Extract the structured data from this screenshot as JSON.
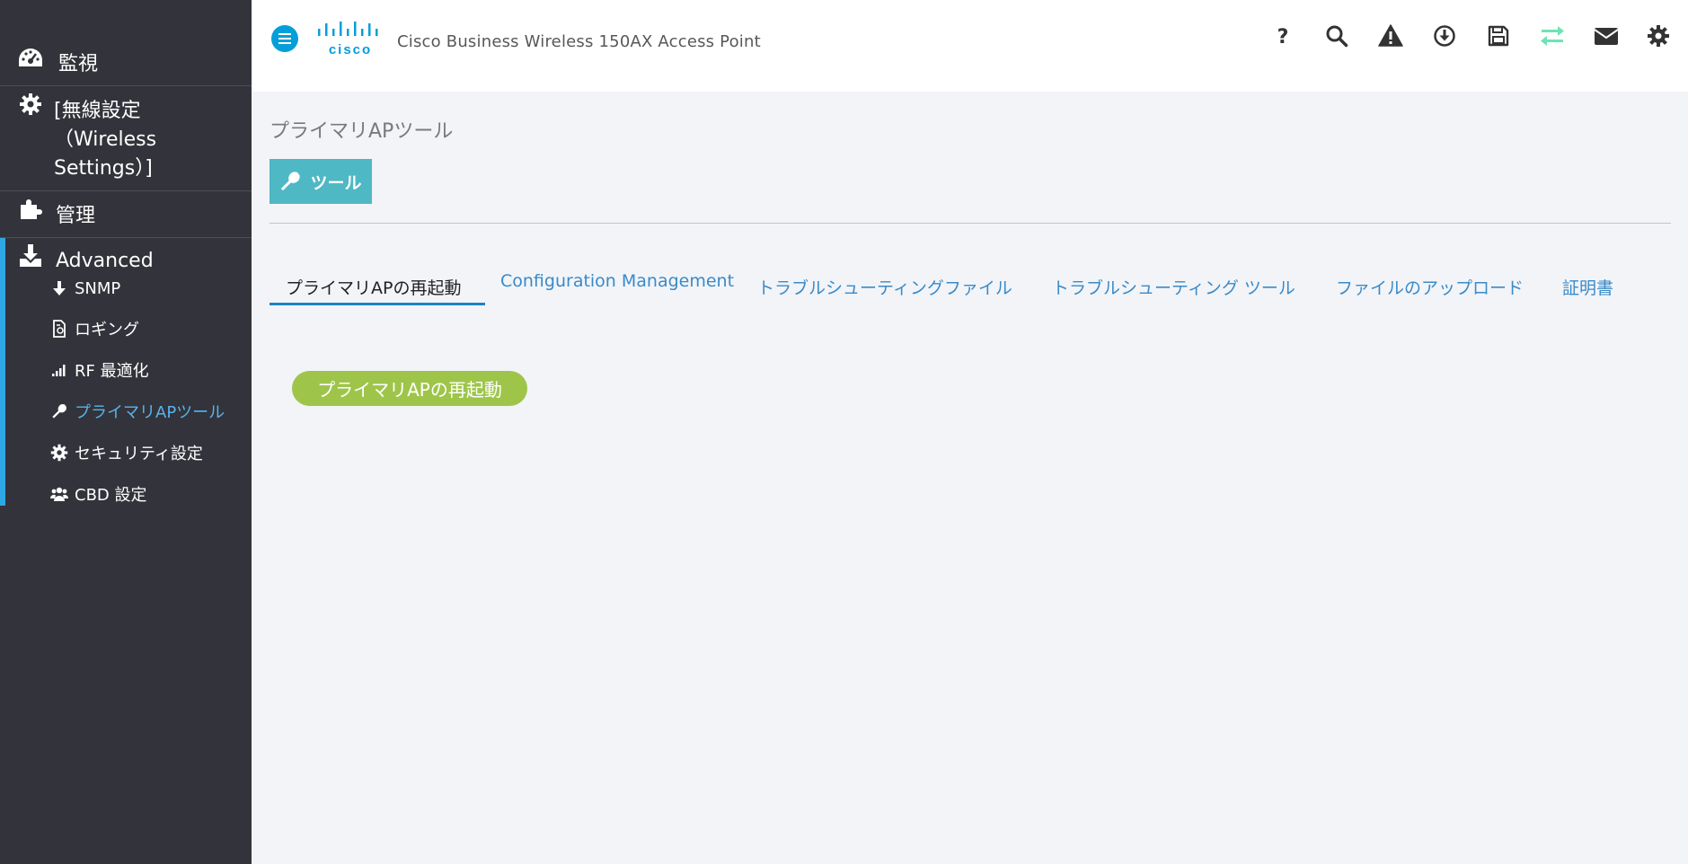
{
  "header": {
    "title": "Cisco Business Wireless 150AX Access Point",
    "logo_text": "cisco",
    "icons": [
      "help-icon",
      "search-icon",
      "alert-icon",
      "download-icon",
      "save-icon",
      "sync-icon",
      "mail-icon",
      "gear-icon"
    ],
    "accent_color": "#049fd9",
    "sync_color": "#6fe3b5"
  },
  "sidebar": {
    "items": [
      {
        "label": "監視",
        "icon": "dashboard-icon"
      },
      {
        "label": "[無線設定\n（Wireless\nSettings）]",
        "icon": "gear-icon"
      },
      {
        "label": "管理",
        "icon": "puzzle-icon"
      },
      {
        "label": "Advanced",
        "icon": "download-tray-icon"
      }
    ],
    "sub_items": [
      {
        "label": "SNMP",
        "icon": "arrow-down-icon"
      },
      {
        "label": "ロギング",
        "icon": "log-file-icon"
      },
      {
        "label": "RF 最適化",
        "icon": "signal-bars-icon"
      },
      {
        "label": "プライマリAPツール",
        "icon": "wrench-icon"
      },
      {
        "label": "セキュリティ設定",
        "icon": "gear-icon"
      },
      {
        "label": "CBD 設定",
        "icon": "users-icon"
      }
    ],
    "active_sub_index": 3,
    "active_color": "#58b3ea"
  },
  "main": {
    "page_title": "プライマリAPツール",
    "tools_button": "ツール",
    "tabs": [
      {
        "label": "プライマリAPの再起動"
      },
      {
        "label": "Configuration Management"
      },
      {
        "label": "トラブルシューティングファイル"
      },
      {
        "label": "トラブルシューティング ツール"
      },
      {
        "label": "ファイルのアップロード"
      },
      {
        "label": "証明書"
      }
    ],
    "restart_button": "プライマリAPの再起動",
    "restart_color": "#9ec54a"
  }
}
